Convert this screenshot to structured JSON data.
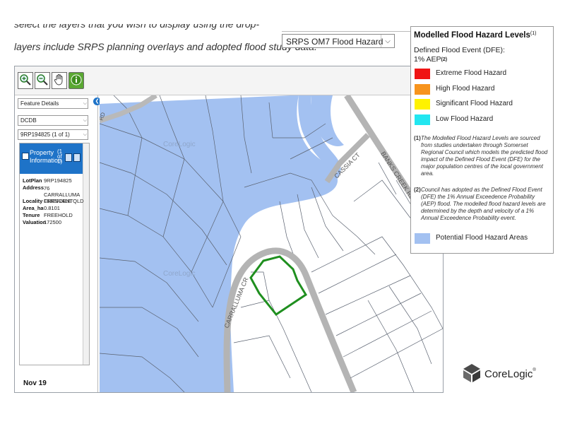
{
  "intro": {
    "line1": "select the layers that you wish to display using the drop-down menu. Available",
    "line2": "layers include SRPS planning overlays and adopted flood study data."
  },
  "layer_select": {
    "value": "SRPS OM7 Flood Hazard"
  },
  "toolbar": {
    "tools": [
      {
        "name": "zoom-in",
        "glyph": "+"
      },
      {
        "name": "zoom-out",
        "glyph": "−"
      },
      {
        "name": "pan",
        "glyph": "✋"
      },
      {
        "name": "info",
        "glyph": "i"
      }
    ]
  },
  "sidebar": {
    "dropdown1": "Feature Details",
    "dropdown2": "DCDB",
    "dropdown3": "9RP194825 (1 of 1)",
    "panel_title_line1": "Property",
    "panel_title_line2": "Information",
    "panel_nav": "(1 of 1)",
    "properties": [
      {
        "key": "LotPlan",
        "value": "9RP194825"
      },
      {
        "key": "Address",
        "value": "76 CARRALLUMA CRESCENT"
      },
      {
        "key": "Locality",
        "value": "FERNVALE QLD"
      },
      {
        "key": "Area_ha",
        "value": "0.8101"
      },
      {
        "key": "Tenure",
        "value": "FREEHOLD"
      },
      {
        "key": "Valuation",
        "value": "172500"
      }
    ]
  },
  "map": {
    "streets": [
      "CARRALLUMA CR",
      "CASSIA CT",
      "BANKS CREEK RD",
      "RD"
    ],
    "watermark": "CoreLogic"
  },
  "legend": {
    "title": "Modelled Flood Hazard Levels",
    "title_sup": "(1)",
    "subtitle_line1": "Defined Flood Event (DFE):",
    "subtitle_line2": "1% AEP",
    "subtitle_sup": "(2)",
    "items": [
      {
        "label": "Extreme Flood Hazard",
        "color": "#f01414"
      },
      {
        "label": "High Flood Hazard",
        "color": "#f7941d"
      },
      {
        "label": "Significant Flood Hazard",
        "color": "#fff200"
      },
      {
        "label": "Low Flood Hazard",
        "color": "#22e6f0"
      }
    ],
    "note1_num": "(1)",
    "note1": "The Modelled Flood Hazard Levels are sourced from studies undertaken through Somerset Regional Council which models the predicted flood impact of the Defined Flood Event (DFE) for the major population centres of the local government area.",
    "note2_num": "(2)",
    "note2": "Council has adopted as the Defined Flood Event (DFE) the 1% Annual Exceedence Probability (AEP) flood. The modelled flood hazard levels are determined by the depth and velocity of a 1% Annual Exceedence Probability event.",
    "potential_label": "Potential Flood Hazard Areas",
    "potential_color": "#a3c1f1"
  },
  "date_stamp": "Nov 19",
  "brand": {
    "name": "CoreLogic",
    "mark": "®"
  }
}
